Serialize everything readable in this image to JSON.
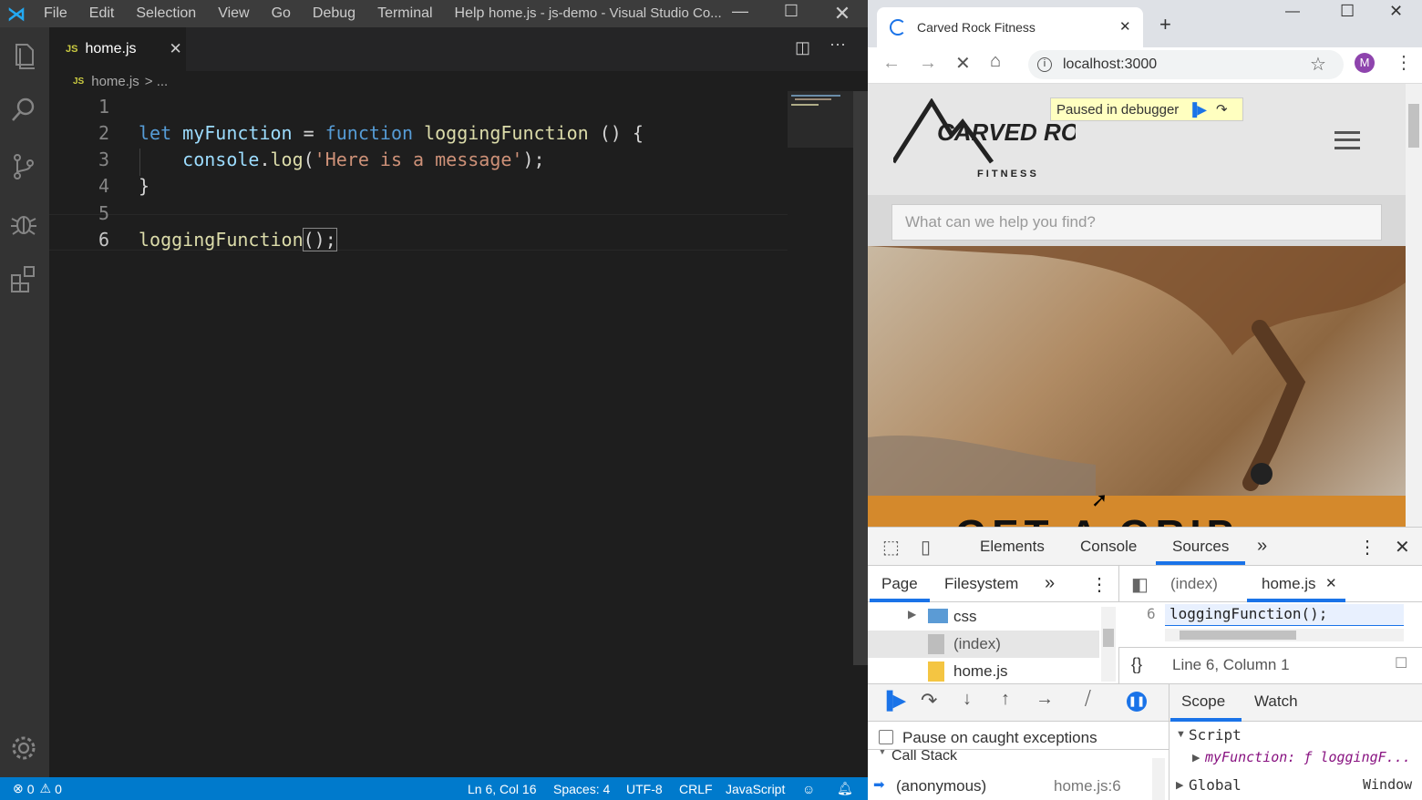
{
  "vscode": {
    "menu": [
      "File",
      "Edit",
      "Selection",
      "View",
      "Go",
      "Debug",
      "Terminal",
      "Help"
    ],
    "window_title": "home.js - js-demo - Visual Studio Co...",
    "tab_label": "home.js",
    "breadcrumb_file": "home.js",
    "breadcrumb_rest": "> ...",
    "line_numbers": [
      "1",
      "2",
      "3",
      "4",
      "5",
      "6"
    ],
    "code": {
      "l2_let": "let ",
      "l2_var": "myFunction",
      "l2_eq": " = ",
      "l2_function": "function ",
      "l2_name": "loggingFunction",
      "l2_rest": " () {",
      "l3_console": "    console",
      "l3_dot": ".",
      "l3_log": "log",
      "l3_open": "(",
      "l3_str": "'Here is a message'",
      "l3_close": ");",
      "l4": "}",
      "l6_name": "loggingFunction",
      "l6_rest": "();"
    },
    "status": {
      "errors": "0",
      "warnings": "0",
      "position": "Ln 6, Col 16",
      "spaces": "Spaces: 4",
      "encoding": "UTF-8",
      "eol": "CRLF",
      "language": "JavaScript"
    }
  },
  "chrome": {
    "tab_title": "Carved Rock Fitness",
    "url": "localhost:3000",
    "avatar": "M",
    "paused_text": "Paused in debugger",
    "search_placeholder": "What can we help you find?",
    "logo_text": "CARVED ROCK",
    "logo_sub": "F I T N E S S",
    "banner_text": "GET A GRIP"
  },
  "devtools": {
    "tabs": [
      "Elements",
      "Console",
      "Sources"
    ],
    "nav_tabs": [
      "Page",
      "Filesystem"
    ],
    "files": [
      "css",
      "(index)",
      "home.js"
    ],
    "editor_tabs": [
      "(index)",
      "home.js"
    ],
    "code_line_no": "6",
    "code_line": "loggingFunction();",
    "cursor_pos": "Line 6, Column 1",
    "pause_caught": "Pause on caught exceptions",
    "call_stack": "Call Stack",
    "frame_name": "(anonymous)",
    "frame_loc": "home.js:6",
    "scope_tabs": [
      "Scope",
      "Watch"
    ],
    "scope_script": "Script",
    "scope_var": "myFunction: ƒ loggingF...",
    "scope_global": "Global",
    "scope_global_val": "Window"
  }
}
